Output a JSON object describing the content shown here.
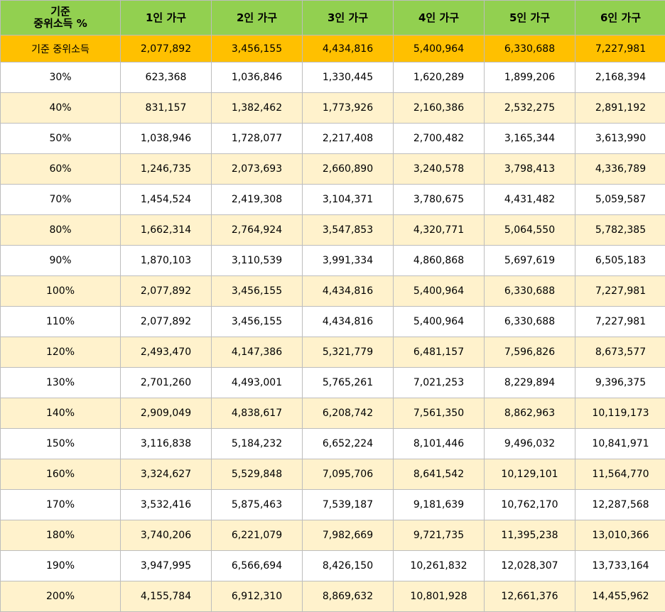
{
  "table": {
    "corner_label_line1": "기준",
    "corner_label_line2": "중위소득 %",
    "household_headers": [
      "1인 가구",
      "2인 가구",
      "3인 가구",
      "4인 가구",
      "5인 가구",
      "6인 가구"
    ],
    "median_row": {
      "label": "기준 중위소득",
      "values": [
        "2,077,892",
        "3,456,155",
        "4,434,816",
        "5,400,964",
        "6,330,688",
        "7,227,981"
      ]
    },
    "rows": [
      {
        "percent": "30%",
        "values": [
          "623,368",
          "1,036,846",
          "1,330,445",
          "1,620,289",
          "1,899,206",
          "2,168,394"
        ]
      },
      {
        "percent": "40%",
        "values": [
          "831,157",
          "1,382,462",
          "1,773,926",
          "2,160,386",
          "2,532,275",
          "2,891,192"
        ]
      },
      {
        "percent": "50%",
        "values": [
          "1,038,946",
          "1,728,077",
          "2,217,408",
          "2,700,482",
          "3,165,344",
          "3,613,990"
        ]
      },
      {
        "percent": "60%",
        "values": [
          "1,246,735",
          "2,073,693",
          "2,660,890",
          "3,240,578",
          "3,798,413",
          "4,336,789"
        ]
      },
      {
        "percent": "70%",
        "values": [
          "1,454,524",
          "2,419,308",
          "3,104,371",
          "3,780,675",
          "4,431,482",
          "5,059,587"
        ]
      },
      {
        "percent": "80%",
        "values": [
          "1,662,314",
          "2,764,924",
          "3,547,853",
          "4,320,771",
          "5,064,550",
          "5,782,385"
        ]
      },
      {
        "percent": "90%",
        "values": [
          "1,870,103",
          "3,110,539",
          "3,991,334",
          "4,860,868",
          "5,697,619",
          "6,505,183"
        ]
      },
      {
        "percent": "100%",
        "values": [
          "2,077,892",
          "3,456,155",
          "4,434,816",
          "5,400,964",
          "6,330,688",
          "7,227,981"
        ]
      },
      {
        "percent": "110%",
        "values": [
          "2,077,892",
          "3,456,155",
          "4,434,816",
          "5,400,964",
          "6,330,688",
          "7,227,981"
        ]
      },
      {
        "percent": "120%",
        "values": [
          "2,493,470",
          "4,147,386",
          "5,321,779",
          "6,481,157",
          "7,596,826",
          "8,673,577"
        ]
      },
      {
        "percent": "130%",
        "values": [
          "2,701,260",
          "4,493,001",
          "5,765,261",
          "7,021,253",
          "8,229,894",
          "9,396,375"
        ]
      },
      {
        "percent": "140%",
        "values": [
          "2,909,049",
          "4,838,617",
          "6,208,742",
          "7,561,350",
          "8,862,963",
          "10,119,173"
        ]
      },
      {
        "percent": "150%",
        "values": [
          "3,116,838",
          "5,184,232",
          "6,652,224",
          "8,101,446",
          "9,496,032",
          "10,841,971"
        ]
      },
      {
        "percent": "160%",
        "values": [
          "3,324,627",
          "5,529,848",
          "7,095,706",
          "8,641,542",
          "10,129,101",
          "11,564,770"
        ]
      },
      {
        "percent": "170%",
        "values": [
          "3,532,416",
          "5,875,463",
          "7,539,187",
          "9,181,639",
          "10,762,170",
          "12,287,568"
        ]
      },
      {
        "percent": "180%",
        "values": [
          "3,740,206",
          "6,221,079",
          "7,982,669",
          "9,721,735",
          "11,395,238",
          "13,010,366"
        ]
      },
      {
        "percent": "190%",
        "values": [
          "3,947,995",
          "6,566,694",
          "8,426,150",
          "10,261,832",
          "12,028,307",
          "13,733,164"
        ]
      },
      {
        "percent": "200%",
        "values": [
          "4,155,784",
          "6,912,310",
          "8,869,632",
          "10,801,928",
          "12,661,376",
          "14,455,962"
        ]
      }
    ],
    "colors": {
      "header_bg": "#92d050",
      "median_bg": "#ffc000",
      "stripe_bg": "#fff2cc",
      "row_bg": "#ffffff",
      "border": "#bdbdbd"
    }
  }
}
